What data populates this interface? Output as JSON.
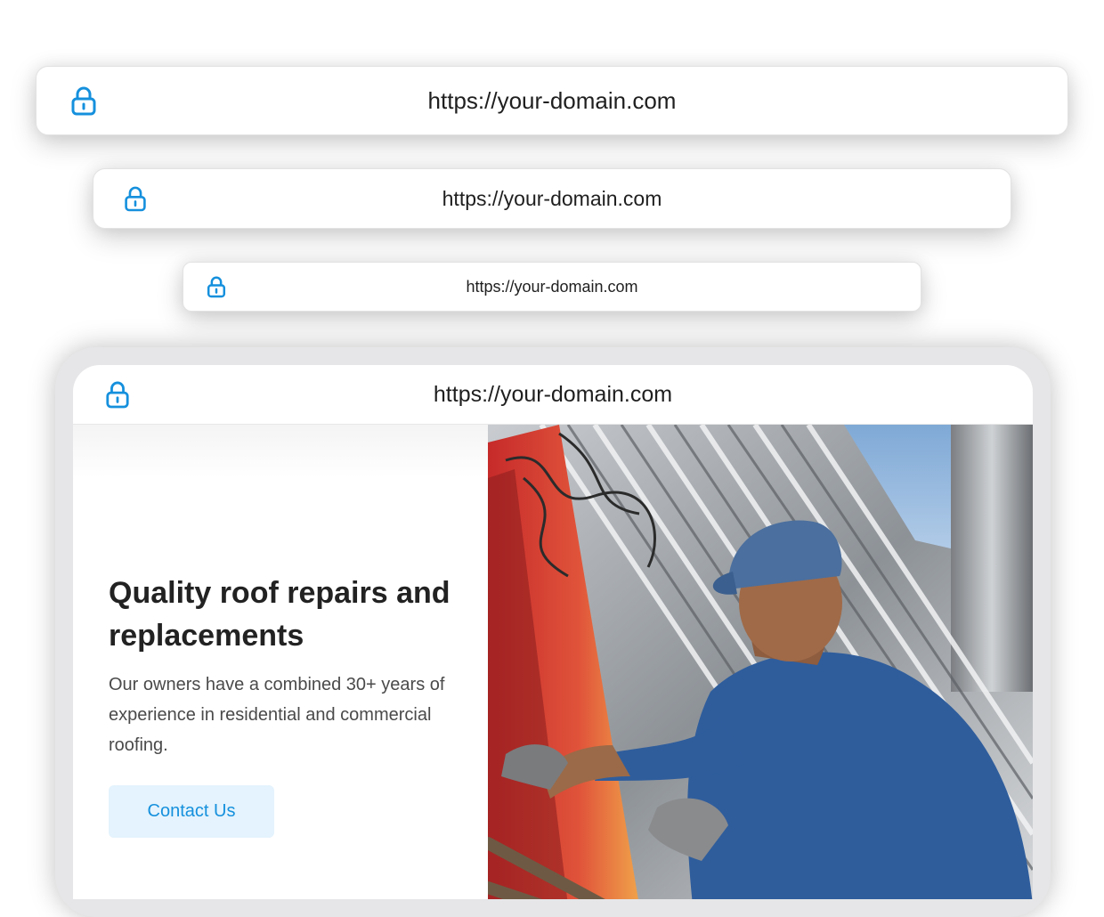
{
  "url_bars": [
    {
      "url": "https://your-domain.com"
    },
    {
      "url": "https://your-domain.com"
    },
    {
      "url": "https://your-domain.com"
    }
  ],
  "device": {
    "url": "https://your-domain.com",
    "hero": {
      "title": "Quality roof repairs and replacements",
      "description": "Our owners have a combined 30+ years of experience in residential and commercial roofing.",
      "cta_label": "Contact Us"
    }
  },
  "colors": {
    "accent": "#1590dd",
    "cta_background": "#e4f3fd",
    "heading": "#222222",
    "body_text": "#4a4a4a"
  },
  "icons": {
    "lock": "lock-icon"
  }
}
